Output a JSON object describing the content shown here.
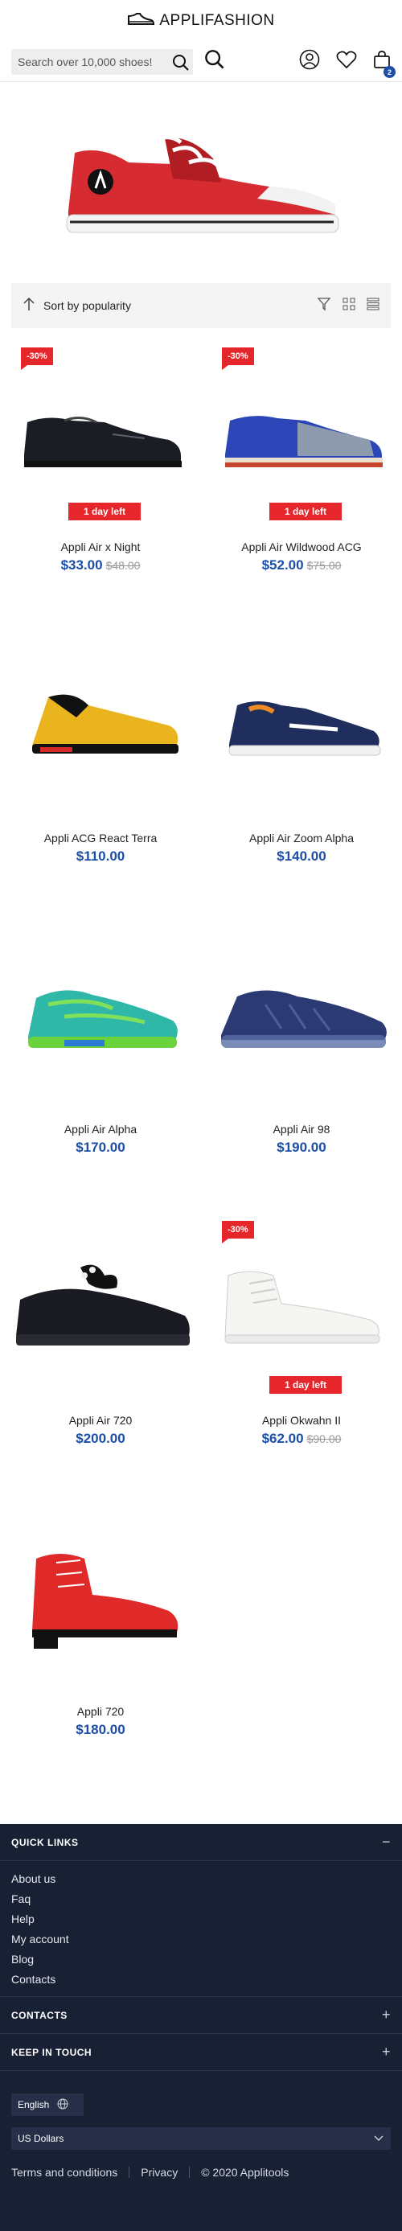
{
  "header": {
    "logo_text": "APPLIFASHION",
    "search_placeholder": "Search over 10,000 shoes!",
    "cart_count": "2"
  },
  "sort": {
    "label": "Sort by popularity"
  },
  "products": [
    {
      "name": "Appli Air x Night",
      "price": "$33.00",
      "old_price": "$48.00",
      "discount": "-30%",
      "timer": "1 day left"
    },
    {
      "name": "Appli Air Wildwood ACG",
      "price": "$52.00",
      "old_price": "$75.00",
      "discount": "-30%",
      "timer": "1 day left"
    },
    {
      "name": "Appli ACG React Terra",
      "price": "$110.00"
    },
    {
      "name": "Appli Air Zoom Alpha",
      "price": "$140.00"
    },
    {
      "name": "Appli Air Alpha",
      "price": "$170.00"
    },
    {
      "name": "Appli Air 98",
      "price": "$190.00"
    },
    {
      "name": "Appli Air 720",
      "price": "$200.00"
    },
    {
      "name": "Appli Okwahn II",
      "price": "$62.00",
      "old_price": "$90.00",
      "discount": "-30%",
      "timer": "1 day left"
    },
    {
      "name": "Appli 720",
      "price": "$180.00"
    }
  ],
  "footer": {
    "quick_links_title": "QUICK LINKS",
    "quick_links_toggle": "−",
    "links": [
      "About us",
      "Faq",
      "Help",
      "My account",
      "Blog",
      "Contacts"
    ],
    "contacts_title": "CONTACTS",
    "keep_in_touch_title": "KEEP IN TOUCH",
    "plus": "+",
    "language": "English",
    "currency": "US Dollars",
    "terms": "Terms and conditions",
    "privacy": "Privacy",
    "copyright": "© 2020 Applitools"
  }
}
